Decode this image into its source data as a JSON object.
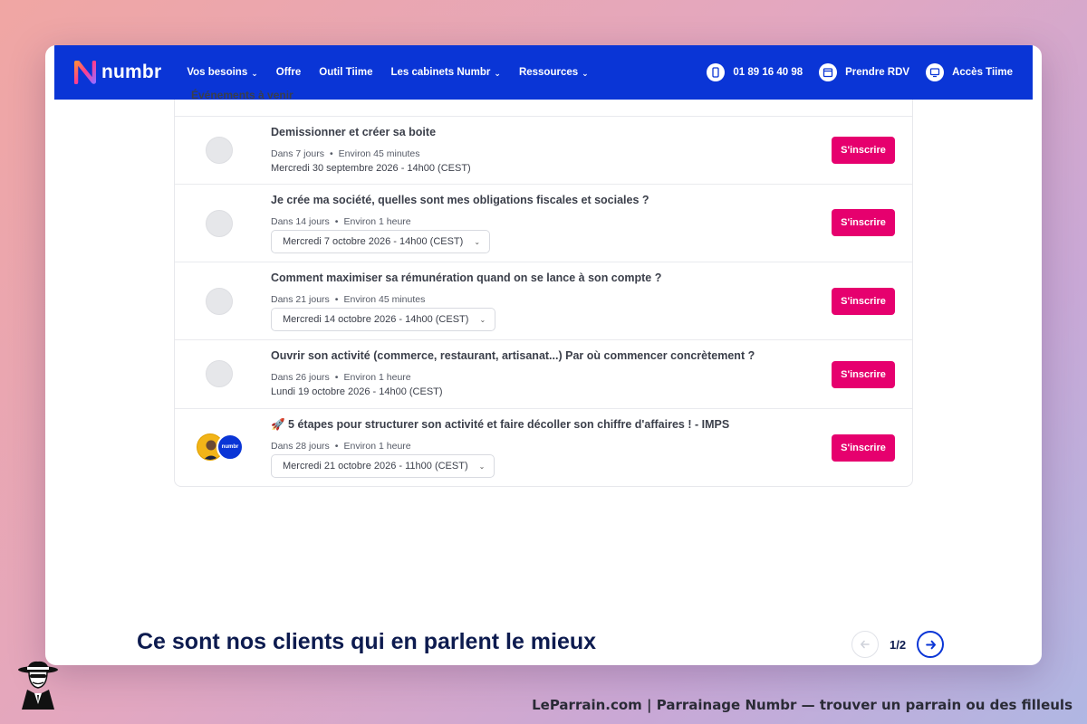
{
  "header": {
    "logo_text": "numbr",
    "nav": [
      {
        "label": "Vos besoins",
        "dropdown": true
      },
      {
        "label": "Offre",
        "dropdown": false
      },
      {
        "label": "Outil Tiime",
        "dropdown": false
      },
      {
        "label": "Les cabinets Numbr",
        "dropdown": true
      },
      {
        "label": "Ressources",
        "dropdown": true
      }
    ],
    "phone": "01 89 16 40 98",
    "rdv": "Prendre RDV",
    "access": "Accès Tiime",
    "brand_color": "#0a35d6"
  },
  "events": {
    "section_title_clipped": "Événements à venir",
    "button_label": "S'inscrire",
    "button_color": "#e6006e",
    "items": [
      {
        "title": "Demissionner et créer sa boite",
        "in": "Dans 7 jours",
        "duration": "Environ 45 minutes",
        "date": "Mercredi 30 septembre 2026 - 14h00 (CEST)",
        "select": false,
        "avatar": "placeholder"
      },
      {
        "title": "Je crée ma société, quelles sont mes obligations fiscales et sociales ?",
        "in": "Dans 14 jours",
        "duration": "Environ 1 heure",
        "date": "Mercredi 7 octobre 2026 - 14h00 (CEST)",
        "select": true,
        "avatar": "placeholder"
      },
      {
        "title": "Comment maximiser sa rémunération quand on se lance à son compte ?",
        "in": "Dans 21 jours",
        "duration": "Environ 45 minutes",
        "date": "Mercredi 14 octobre 2026 - 14h00 (CEST)",
        "select": true,
        "avatar": "placeholder"
      },
      {
        "title": "Ouvrir son activité (commerce, restaurant, artisanat...) Par où commencer concrètement ?",
        "in": "Dans 26 jours",
        "duration": "Environ 1 heure",
        "date": "Lundi 19 octobre 2026 - 14h00 (CEST)",
        "select": false,
        "avatar": "placeholder"
      },
      {
        "title": "🚀 5 étapes pour structurer son activité et faire décoller son chiffre d'affaires ! - IMPS",
        "in": "Dans 28 jours",
        "duration": "Environ 1 heure",
        "date": "Mercredi 21 octobre 2026 - 11h00 (CEST)",
        "select": true,
        "avatar": "duo",
        "avatar_brand": "numbr"
      }
    ]
  },
  "testimonials": {
    "title": "Ce sont nos clients qui en parlent le mieux",
    "page": "1/2"
  },
  "footer": {
    "text": "LeParrain.com | Parrainage Numbr — trouver un parrain ou des filleuls"
  }
}
